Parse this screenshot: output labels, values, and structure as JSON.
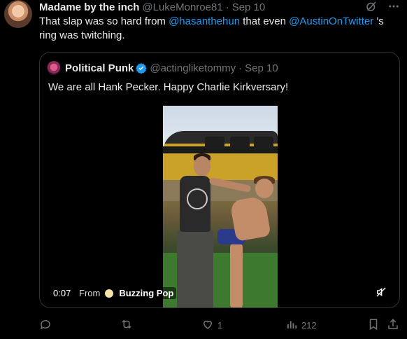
{
  "tweet": {
    "author_name": "Madame by the inch",
    "author_handle": "@LukeMonroe81",
    "separator": "·",
    "date": "Sep 10",
    "text_part1": "That slap was so hard from ",
    "mention1": "@hasanthehun",
    "text_part2": " that even ",
    "mention2": "@AustinOnTwitter",
    "text_part3": " 's ring was twitching."
  },
  "quote": {
    "author_name": "Political Punk",
    "author_handle": "@actingliketommy",
    "separator": "·",
    "date": "Sep 10",
    "text": "We are all Hank Pecker. Happy Charlie Kirkversary!",
    "video": {
      "time": "0:07",
      "from_label": "From",
      "source_name": "Buzzing Pop"
    }
  },
  "actions": {
    "reply_count": "",
    "repost_count": "",
    "like_count": "1",
    "views_count": "212"
  },
  "colors": {
    "background": "#000000",
    "text": "#e7e9ea",
    "muted": "#71767b",
    "link": "#1d9bf0",
    "border": "#2f3336",
    "verified": "#1d9bf0"
  },
  "icons": [
    "grok-icon",
    "more-icon",
    "verified-icon",
    "mute-icon",
    "reply-icon",
    "repost-icon",
    "like-icon",
    "views-icon",
    "bookmark-icon",
    "share-icon"
  ]
}
